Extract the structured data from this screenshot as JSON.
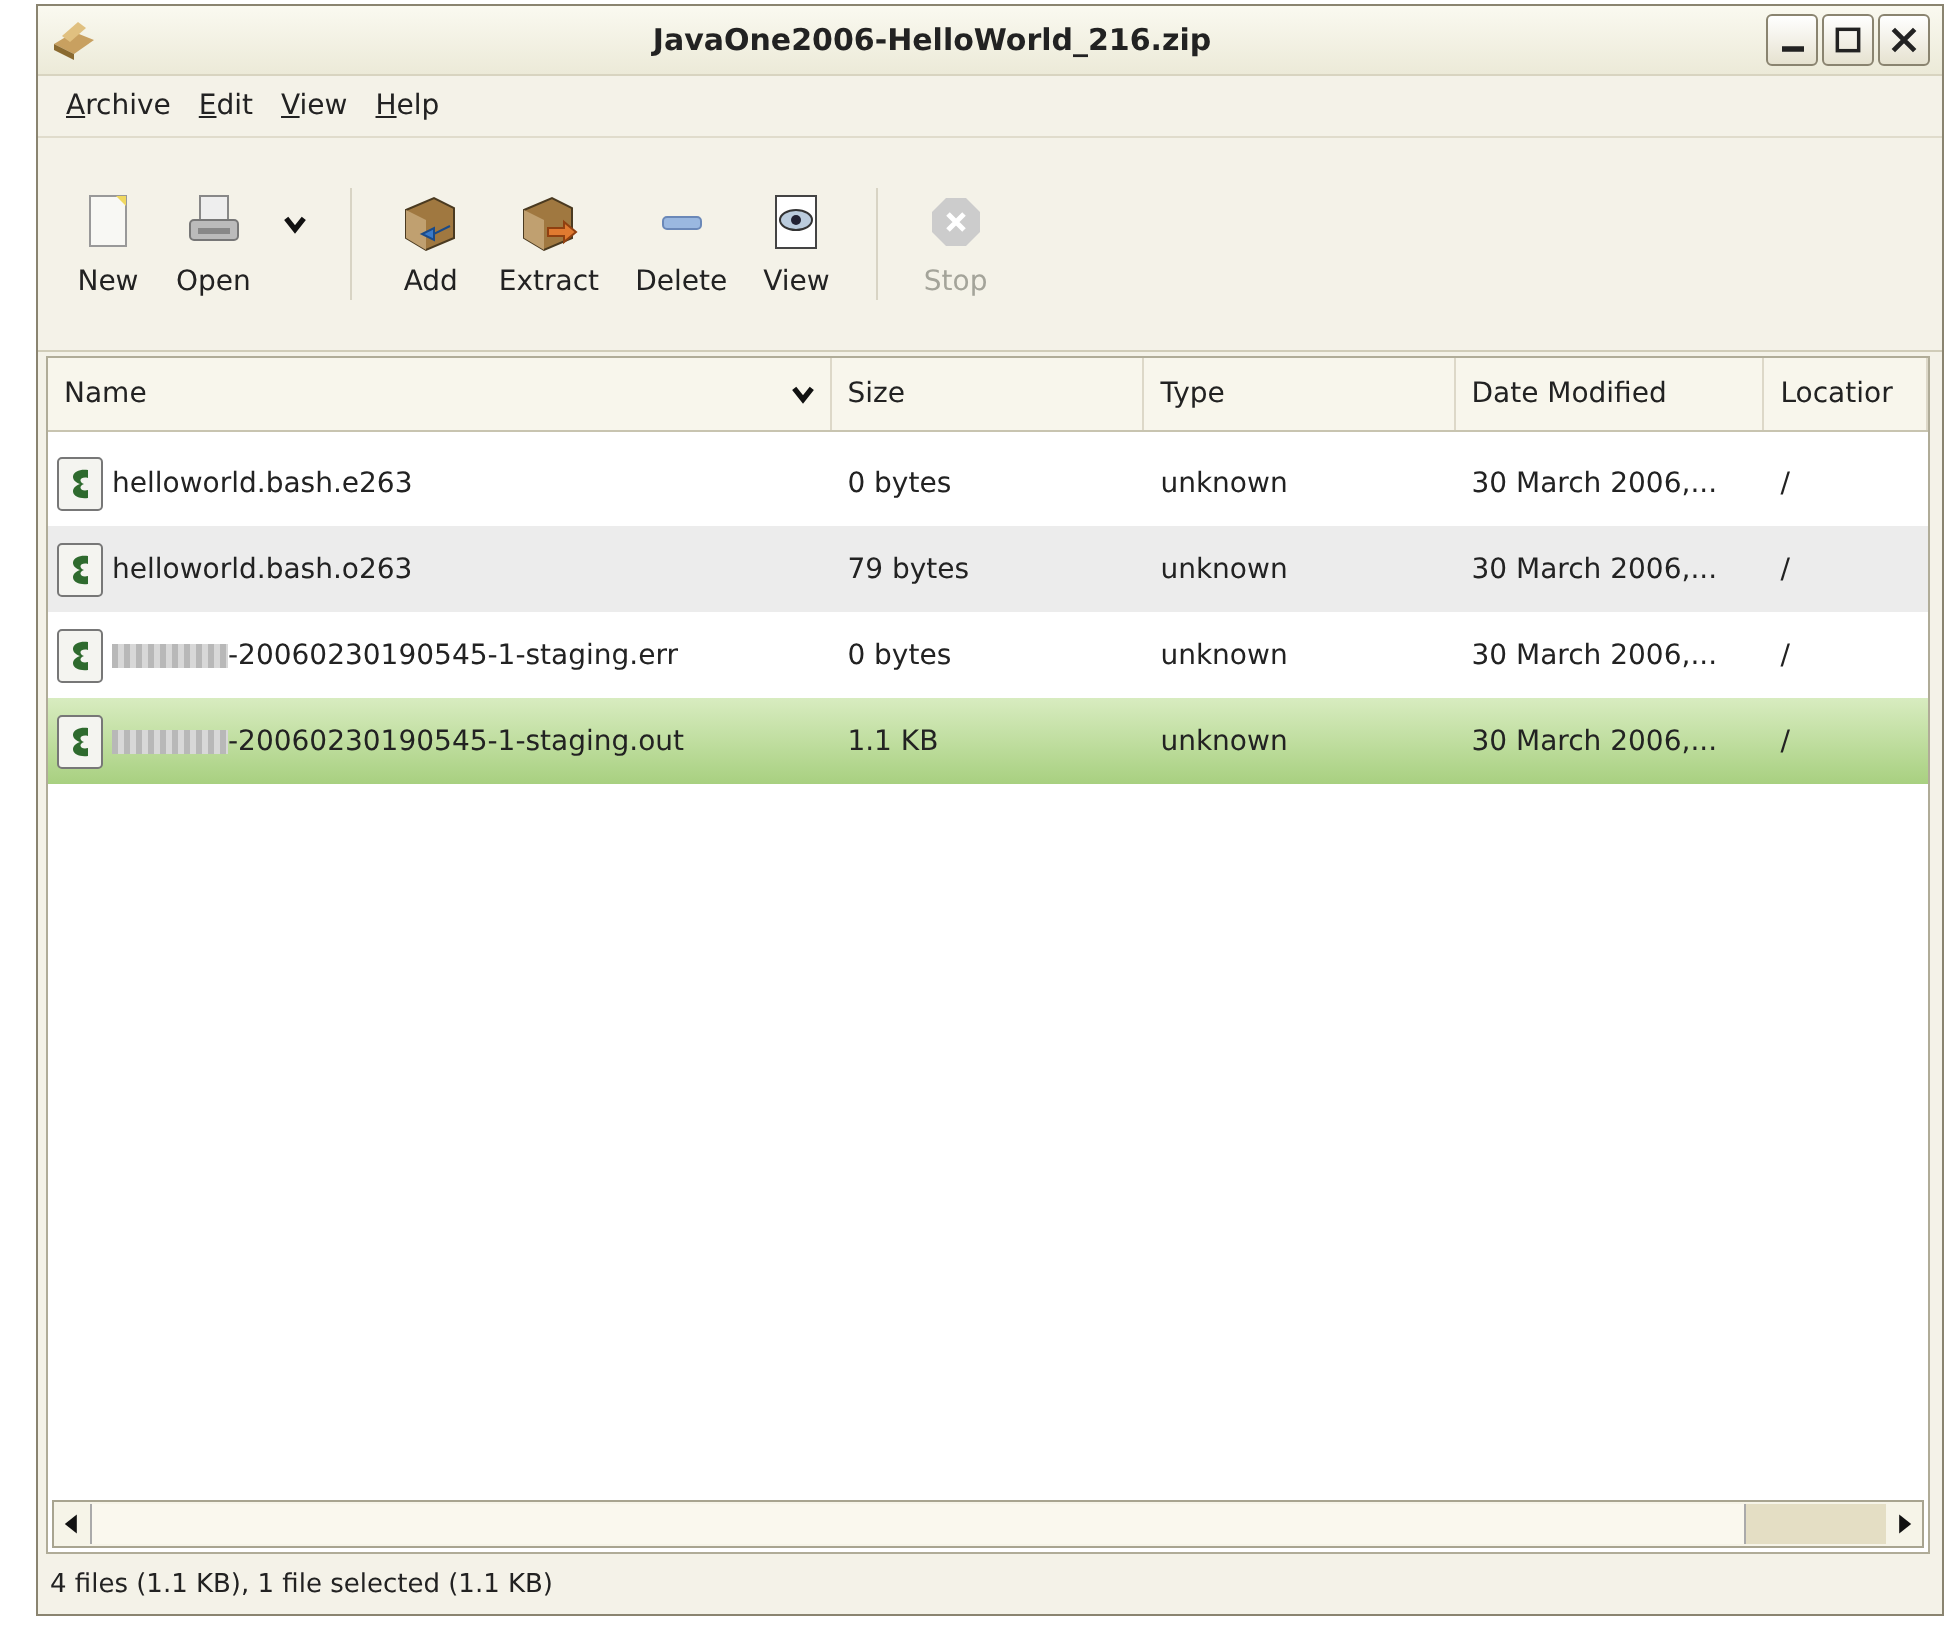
{
  "window": {
    "title": "JavaOne2006-HelloWorld_216.zip"
  },
  "menu": [
    {
      "label": "Archive",
      "mnemonic_underlined": true
    },
    {
      "label": "Edit",
      "mnemonic_underlined": true
    },
    {
      "label": "View",
      "mnemonic_underlined": true
    },
    {
      "label": "Help",
      "mnemonic_underlined": true
    }
  ],
  "toolbar": [
    {
      "kind": "button",
      "label": "New",
      "disabled": false
    },
    {
      "kind": "button",
      "label": "Open",
      "disabled": false
    },
    {
      "kind": "dropdown"
    },
    {
      "kind": "separator"
    },
    {
      "kind": "button",
      "label": "Add",
      "disabled": false
    },
    {
      "kind": "button",
      "label": "Extract",
      "disabled": false
    },
    {
      "kind": "button",
      "label": "Delete",
      "disabled": false
    },
    {
      "kind": "button",
      "label": "View",
      "disabled": false
    },
    {
      "kind": "separator"
    },
    {
      "kind": "button",
      "label": "Stop",
      "disabled": true
    }
  ],
  "table": {
    "columns": [
      {
        "label": "Name",
        "sorted": true
      },
      {
        "label": "Size",
        "sorted": false
      },
      {
        "label": "Type",
        "sorted": false
      },
      {
        "label": "Date Modified",
        "sorted": false
      },
      {
        "label": "Locatior",
        "sorted": false
      }
    ],
    "rows": [
      {
        "name": "helloworld.bash.e263",
        "redacted": false,
        "size": "0 bytes",
        "type": "unknown",
        "date": "30 March 2006,...",
        "location": "/",
        "selected": false
      },
      {
        "name": "helloworld.bash.o263",
        "redacted": false,
        "size": "79 bytes",
        "type": "unknown",
        "date": "30 March 2006,...",
        "location": "/",
        "selected": false
      },
      {
        "name": "-20060230190545-1-staging.err",
        "redacted": true,
        "size": "0 bytes",
        "type": "unknown",
        "date": "30 March 2006,...",
        "location": "/",
        "selected": false
      },
      {
        "name": "-20060230190545-1-staging.out",
        "redacted": true,
        "size": "1.1 KB",
        "type": "unknown",
        "date": "30 March 2006,...",
        "location": "/",
        "selected": true
      }
    ]
  },
  "status_bar": "4 files (1.1 KB), 1 file selected (1.1 KB)"
}
